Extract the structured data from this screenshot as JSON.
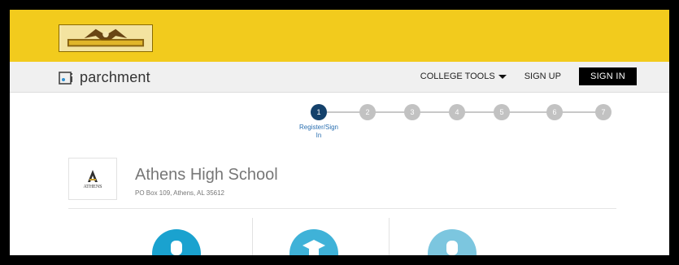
{
  "header": {
    "school_logo_icon": "athens-golden-eagles-logo"
  },
  "nav": {
    "brand_icon": "parchment-logo-icon",
    "brand": "parchment",
    "college_tools": "COLLEGE TOOLS",
    "sign_up": "SIGN UP",
    "sign_in": "SIGN IN"
  },
  "stepper": {
    "steps": [
      "1",
      "2",
      "3",
      "4",
      "5",
      "6",
      "7"
    ],
    "active_label": "Register/Sign In",
    "active_step": 1
  },
  "school": {
    "name": "Athens High School",
    "address": "PO Box 109, Athens, AL 35612",
    "card_text": "ATHENS"
  },
  "colors": {
    "gold": "#f2cb1d",
    "navy": "#14416b",
    "option_1": "#1aa2cf",
    "option_2": "#3fb2d8",
    "option_3": "#7cc6df"
  }
}
